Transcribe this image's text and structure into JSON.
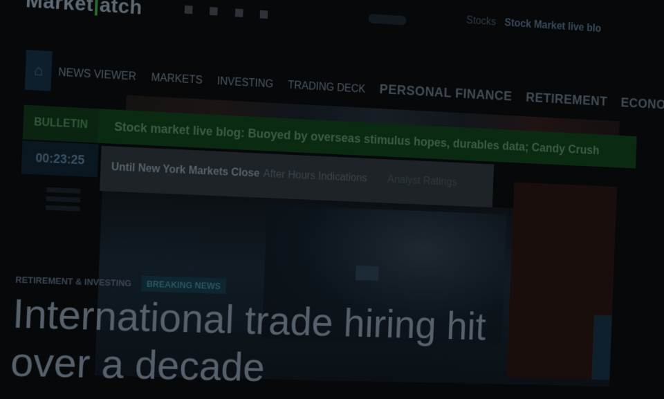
{
  "header": {
    "logo_part1": "Market",
    "logo_part2": "atch",
    "social_icons": [
      "facebook-icon",
      "twitter-icon",
      "linkedin-icon",
      "rss-icon"
    ],
    "ticker": {
      "label": "Stocks",
      "text": "Stock Market live blo"
    }
  },
  "nav": {
    "home_icon": "home-icon",
    "items": [
      {
        "label": "News Viewer"
      },
      {
        "label": "Markets"
      },
      {
        "label": "Investing"
      },
      {
        "label": "Trading Deck"
      },
      {
        "label": "Personal Finance"
      },
      {
        "label": "Retirement"
      },
      {
        "label": "Econo"
      }
    ]
  },
  "bulletin": {
    "label": "BULLETIN",
    "headline": "Stock market live blog: Buoyed by overseas stimulus hopes, durables data; Candy Crush"
  },
  "countdown": {
    "time": "00:23:25"
  },
  "tabs": [
    {
      "label": "Until New York Markets Close"
    },
    {
      "label": "After Hours Indications"
    },
    {
      "label": "Analyst Ratings"
    }
  ],
  "article": {
    "section": "Retirement & Investing",
    "badge": "Breaking News",
    "headline_line1": "International trade hiring hit",
    "headline_line2": "over a decade"
  },
  "colors": {
    "background": "#06080a",
    "bulletin": "#0b2a12",
    "nav_text": "#4a5660",
    "headline": "#56616b"
  }
}
